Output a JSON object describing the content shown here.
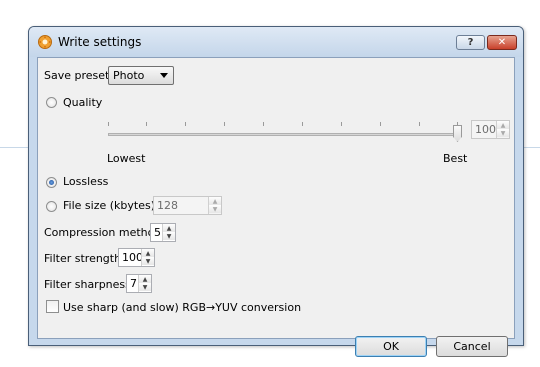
{
  "window": {
    "title": "Write settings",
    "help_label": "?",
    "close_label": "✕"
  },
  "form": {
    "save_preset_label": "Save preset",
    "save_preset_value": "Photo",
    "quality_label": "Quality",
    "quality_value": "100",
    "slider_min_label": "Lowest",
    "slider_max_label": "Best",
    "lossless_label": "Lossless",
    "filesize_label": "File size (kbytes)",
    "filesize_value": "128",
    "compression_label": "Compression method",
    "compression_value": "5",
    "filter_strength_label": "Filter strength",
    "filter_strength_value": "100",
    "filter_sharpness_label": "Filter sharpness",
    "filter_sharpness_value": "7",
    "sharp_yuv_label": "Use sharp (and slow) RGB→YUV conversion",
    "selected_mode": "Lossless",
    "quality_level": 1.0,
    "sharp_yuv_checked": false
  },
  "buttons": {
    "ok": "OK",
    "cancel": "Cancel"
  }
}
